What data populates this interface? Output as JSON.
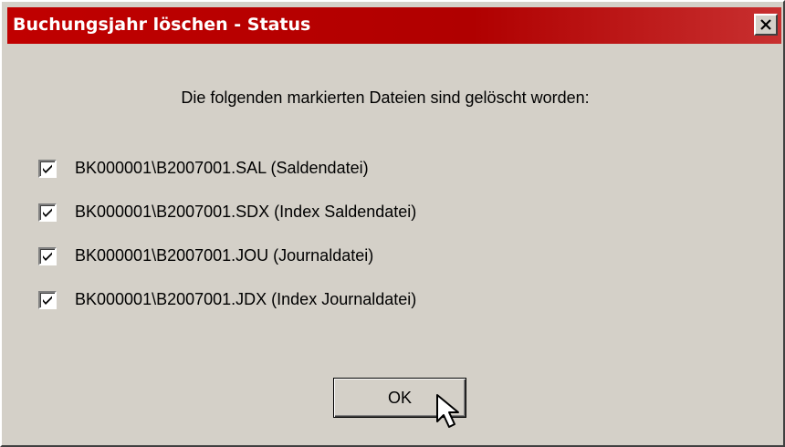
{
  "window": {
    "title": "Buchungsjahr löschen - Status",
    "close_icon": "close-icon"
  },
  "message": "Die folgenden markierten Dateien sind gelöscht worden:",
  "files": [
    {
      "label": "BK000001\\B2007001.SAL (Saldendatei)",
      "checked": true
    },
    {
      "label": "BK000001\\B2007001.SDX (Index Saldendatei)",
      "checked": true
    },
    {
      "label": "BK000001\\B2007001.JOU (Journaldatei)",
      "checked": true
    },
    {
      "label": "BK000001\\B2007001.JDX (Index Journaldatei)",
      "checked": true
    }
  ],
  "ok_button": {
    "label": "OK"
  },
  "colors": {
    "titlebar": "#c00000",
    "dialog_background": "#d4d0c8"
  }
}
